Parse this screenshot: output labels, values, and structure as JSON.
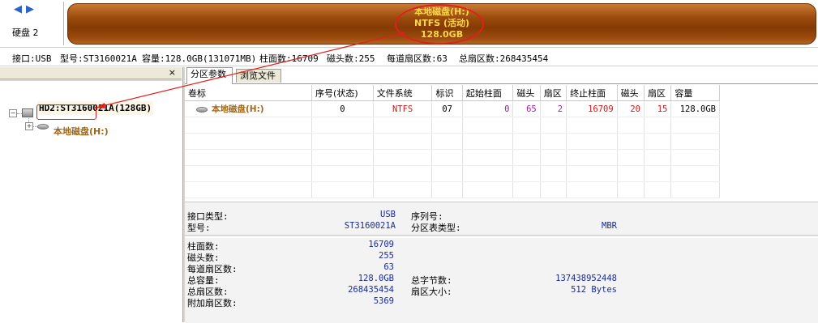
{
  "nav": {
    "back_icon": "arrow-left-icon",
    "forward_icon": "arrow-right-icon"
  },
  "disk_label": "硬盘 2",
  "partition_bar": {
    "line1": "本地磁盘(H:)",
    "line2": "NTFS (活动)",
    "line3": "128.0GB",
    "color": "#9a4a0c",
    "text_color": "#ffd84a"
  },
  "infostrip": {
    "interface": "接口:USB",
    "model": "型号:ST3160021A",
    "capacity": "容量:128.0GB(131071MB)",
    "cylinders": "柱面数:16709",
    "heads": "磁头数:255",
    "sectors_per_track": "每道扇区数:63",
    "total_sectors": "总扇区数:268435454"
  },
  "left_panel": {
    "close_label": "×"
  },
  "tree": {
    "disk_label": "HD2:ST3160021A(128GB)",
    "volume_label": "本地磁盘(H:)",
    "expander_minus": "−",
    "expander_plus": "+"
  },
  "tabs": [
    {
      "label": "分区参数"
    },
    {
      "label": "浏览文件"
    }
  ],
  "partition_table": {
    "headers": [
      "卷标",
      "序号(状态)",
      "文件系统",
      "标识",
      "起始柱面",
      "磁头",
      "扇区",
      "终止柱面",
      "磁头",
      "扇区",
      "容量"
    ],
    "rows": [
      {
        "label": "本地磁盘(H:)",
        "index": "0",
        "fs": "NTFS",
        "id": "07",
        "start_cyl": "0",
        "start_head": "65",
        "start_sec": "2",
        "end_cyl": "16709",
        "end_head": "20",
        "end_sec": "15",
        "size": "128.0GB"
      }
    ]
  },
  "info": {
    "interface_label": "接口类型:",
    "interface_value": "USB",
    "serial_label": "序列号:",
    "serial_value": "",
    "model_label": "型号:",
    "model_value": "ST3160021A",
    "ptable_type_label": "分区表类型:",
    "ptable_type_value": "MBR",
    "cylinders_label": "柱面数:",
    "cylinders_value": "16709",
    "heads_label": "磁头数:",
    "heads_value": "255",
    "spt_label": "每道扇区数:",
    "spt_value": "63",
    "capacity_label": "总容量:",
    "capacity_value": "128.0GB",
    "total_bytes_label": "总字节数:",
    "total_bytes_value": "137438952448",
    "total_sectors_label": "总扇区数:",
    "total_sectors_value": "268435454",
    "sector_size_label": "扇区大小:",
    "sector_size_value": "512 Bytes",
    "extra_sectors_label": "附加扇区数:",
    "extra_sectors_value": "5369"
  },
  "colors": {
    "annotation": "#e0201a",
    "value_blue": "#1a2a9a",
    "red": "#d01818",
    "purple": "#a020b0"
  }
}
